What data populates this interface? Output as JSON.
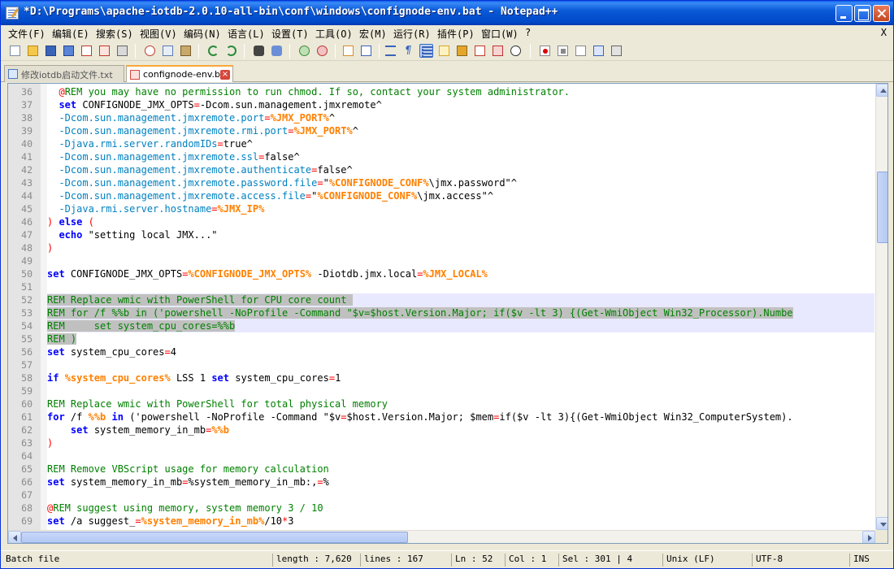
{
  "window": {
    "title": "*D:\\Programs\\apache-iotdb-2.0.10-all-bin\\conf\\windows\\confignode-env.bat - Notepad++"
  },
  "menu": {
    "items": [
      "文件(F)",
      "编辑(E)",
      "搜索(S)",
      "视图(V)",
      "编码(N)",
      "语言(L)",
      "设置(T)",
      "工具(O)",
      "宏(M)",
      "运行(R)",
      "插件(P)",
      "窗口(W)",
      "?"
    ],
    "close_label": "X"
  },
  "toolbar": {
    "icons": [
      "new-file-icon",
      "open-file-icon",
      "save-icon",
      "save-all-icon",
      "close-icon",
      "close-all-icon",
      "print-icon",
      "cut-icon",
      "copy-icon",
      "paste-icon",
      "undo-icon",
      "redo-icon",
      "find-icon",
      "replace-icon",
      "zoom-in-icon",
      "zoom-out-icon",
      "sync-vertical-icon",
      "sync-horizontal-icon",
      "word-wrap-icon",
      "show-all-chars-icon",
      "indent-guide-icon",
      "document-map-icon",
      "function-list-icon",
      "folder-workspace-icon",
      "doc-switcher-icon",
      "monitoring-icon",
      "record-macro-icon",
      "stop-macro-icon",
      "play-macro-icon",
      "play-multiple-icon",
      "save-macro-icon"
    ],
    "colors": {
      "active_bg": "#C1D2EE",
      "active_border": "#316AC5"
    }
  },
  "tabs": [
    {
      "label": "修改iotdb启动文件.txt",
      "active": false
    },
    {
      "label": "confignode-env.bat",
      "active": true
    }
  ],
  "editor": {
    "lines": [
      {
        "n": "36",
        "html": "  <span class='tok-lbl'>@</span><span class='tok-cmt'>REM you may have no permission to run chmod. If so, contact your system administrator.</span>"
      },
      {
        "n": "37",
        "html": "  <span class='tok-kw'>set</span> CONFIGNODE_JMX_OPTS<span class='tok-op'>=</span>-Dcom.sun.management.jmxremote^"
      },
      {
        "n": "38",
        "html": "  <span class='tok-str' style='color:#0080C0'>-Dcom.sun.management.jmxremote.port</span><span class='tok-op'>=</span><span class='tok-var'>%JMX_PORT%</span>^"
      },
      {
        "n": "39",
        "html": "  <span style='color:#0080C0'>-Dcom.sun.management.jmxremote.rmi.port</span><span class='tok-op'>=</span><span class='tok-var'>%JMX_PORT%</span>^"
      },
      {
        "n": "40",
        "html": "  <span style='color:#0080C0'>-Djava.rmi.server.randomIDs</span><span class='tok-op'>=</span>true^"
      },
      {
        "n": "41",
        "html": "  <span style='color:#0080C0'>-Dcom.sun.management.jmxremote.ssl</span><span class='tok-op'>=</span>false^"
      },
      {
        "n": "42",
        "html": "  <span style='color:#0080C0'>-Dcom.sun.management.jmxremote.authenticate</span><span class='tok-op'>=</span>false^"
      },
      {
        "n": "43",
        "html": "  <span style='color:#0080C0'>-Dcom.sun.management.jmxremote.password.file</span><span class='tok-op'>=</span>\"<span class='tok-var'>%CONFIGNODE_CONF%</span>\\jmx.password\"^"
      },
      {
        "n": "44",
        "html": "  <span style='color:#0080C0'>-Dcom.sun.management.jmxremote.access.file</span><span class='tok-op'>=</span>\"<span class='tok-var'>%CONFIGNODE_CONF%</span>\\jmx.access\"^"
      },
      {
        "n": "45",
        "html": "  <span style='color:#0080C0'>-Djava.rmi.server.hostname</span><span class='tok-op'>=</span><span class='tok-var'>%JMX_IP%</span>"
      },
      {
        "n": "46",
        "html": "<span class='tok-op'>)</span> <span class='tok-kw'>else</span> <span class='tok-op'>(</span>"
      },
      {
        "n": "47",
        "html": "  <span class='tok-kw'>echo</span> \"setting local JMX...\""
      },
      {
        "n": "48",
        "html": "<span class='tok-op'>)</span>"
      },
      {
        "n": "49",
        "html": ""
      },
      {
        "n": "50",
        "html": "<span class='tok-kw'>set</span> CONFIGNODE_JMX_OPTS<span class='tok-op'>=</span><span class='tok-var'>%CONFIGNODE_JMX_OPTS%</span> -Diotdb.jmx.local<span class='tok-op'>=</span><span class='tok-var'>%JMX_LOCAL%</span>"
      },
      {
        "n": "51",
        "html": ""
      },
      {
        "n": "52",
        "html": "<span class='sel-mark'><span class='tok-cmt'>REM Replace wmic with PowerShell for CPU core count </span></span>",
        "cls": "curline"
      },
      {
        "n": "53",
        "html": "<span class='sel-mark'><span class='tok-cmt'>REM for /f %%b in ('powershell -NoProfile -Command \"$v=$host.Version.Major; if($v -lt 3) {(Get-WmiObject Win32_Processor).Numbe</span></span>",
        "cls": "curline"
      },
      {
        "n": "54",
        "html": "<span class='sel-mark'><span class='tok-cmt'>REM     set system_cpu_cores=%%b</span></span>",
        "cls": "curline"
      },
      {
        "n": "55",
        "html": "<span class='sel-mark'><span class='tok-cmt'>REM )</span></span>",
        "cls": ""
      },
      {
        "n": "56",
        "html": "<span class='tok-kw'>set</span> system_cpu_cores<span class='tok-op'>=</span>4"
      },
      {
        "n": "57",
        "html": ""
      },
      {
        "n": "58",
        "html": "<span class='tok-kw'>if</span> <span class='tok-var'>%system_cpu_cores%</span> LSS 1 <span class='tok-kw'>set</span> system_cpu_cores<span class='tok-op'>=</span>1"
      },
      {
        "n": "59",
        "html": ""
      },
      {
        "n": "60",
        "html": "<span class='tok-cmt'>REM Replace wmic with PowerShell for total physical memory</span>"
      },
      {
        "n": "61",
        "html": "<span class='tok-kw'>for</span> /f <span class='tok-var'>%%b</span> <span class='tok-kw'>in</span> ('powershell -NoProfile -Command \"$v<span class='tok-op'>=</span>$host.Version.Major; $mem<span class='tok-op'>=</span>if($v -lt 3){(Get-WmiObject Win32_ComputerSystem)."
      },
      {
        "n": "62",
        "html": "    <span class='tok-kw'>set</span> system_memory_in_mb<span class='tok-op'>=</span><span class='tok-var'>%%b</span>"
      },
      {
        "n": "63",
        "html": "<span class='tok-op'>)</span>"
      },
      {
        "n": "64",
        "html": ""
      },
      {
        "n": "65",
        "html": "<span class='tok-cmt'>REM Remove VBScript usage for memory calculation</span>"
      },
      {
        "n": "66",
        "html": "<span class='tok-kw'>set</span> system_memory_in_mb<span class='tok-op'>=</span>%system_memory_in_mb:,<span class='tok-op'>=</span>%"
      },
      {
        "n": "67",
        "html": ""
      },
      {
        "n": "68",
        "html": "<span class='tok-lbl'>@</span><span class='tok-cmt'>REM suggest using memory, system memory 3 / 10</span>"
      },
      {
        "n": "69",
        "html": "<span class='tok-kw'>set</span> /a suggest_<span class='tok-op'>=</span><span class='tok-var'>%system_memory_in_mb%</span>/10<span class='tok-op'>*</span>3"
      }
    ]
  },
  "status": {
    "type": "Batch file",
    "length": "length : 7,620",
    "lines": "lines : 167",
    "ln": "Ln : 52",
    "col": "Col : 1",
    "sel": "Sel : 301 | 4",
    "eol": "Unix (LF)",
    "encoding": "UTF-8",
    "mode": "INS"
  }
}
